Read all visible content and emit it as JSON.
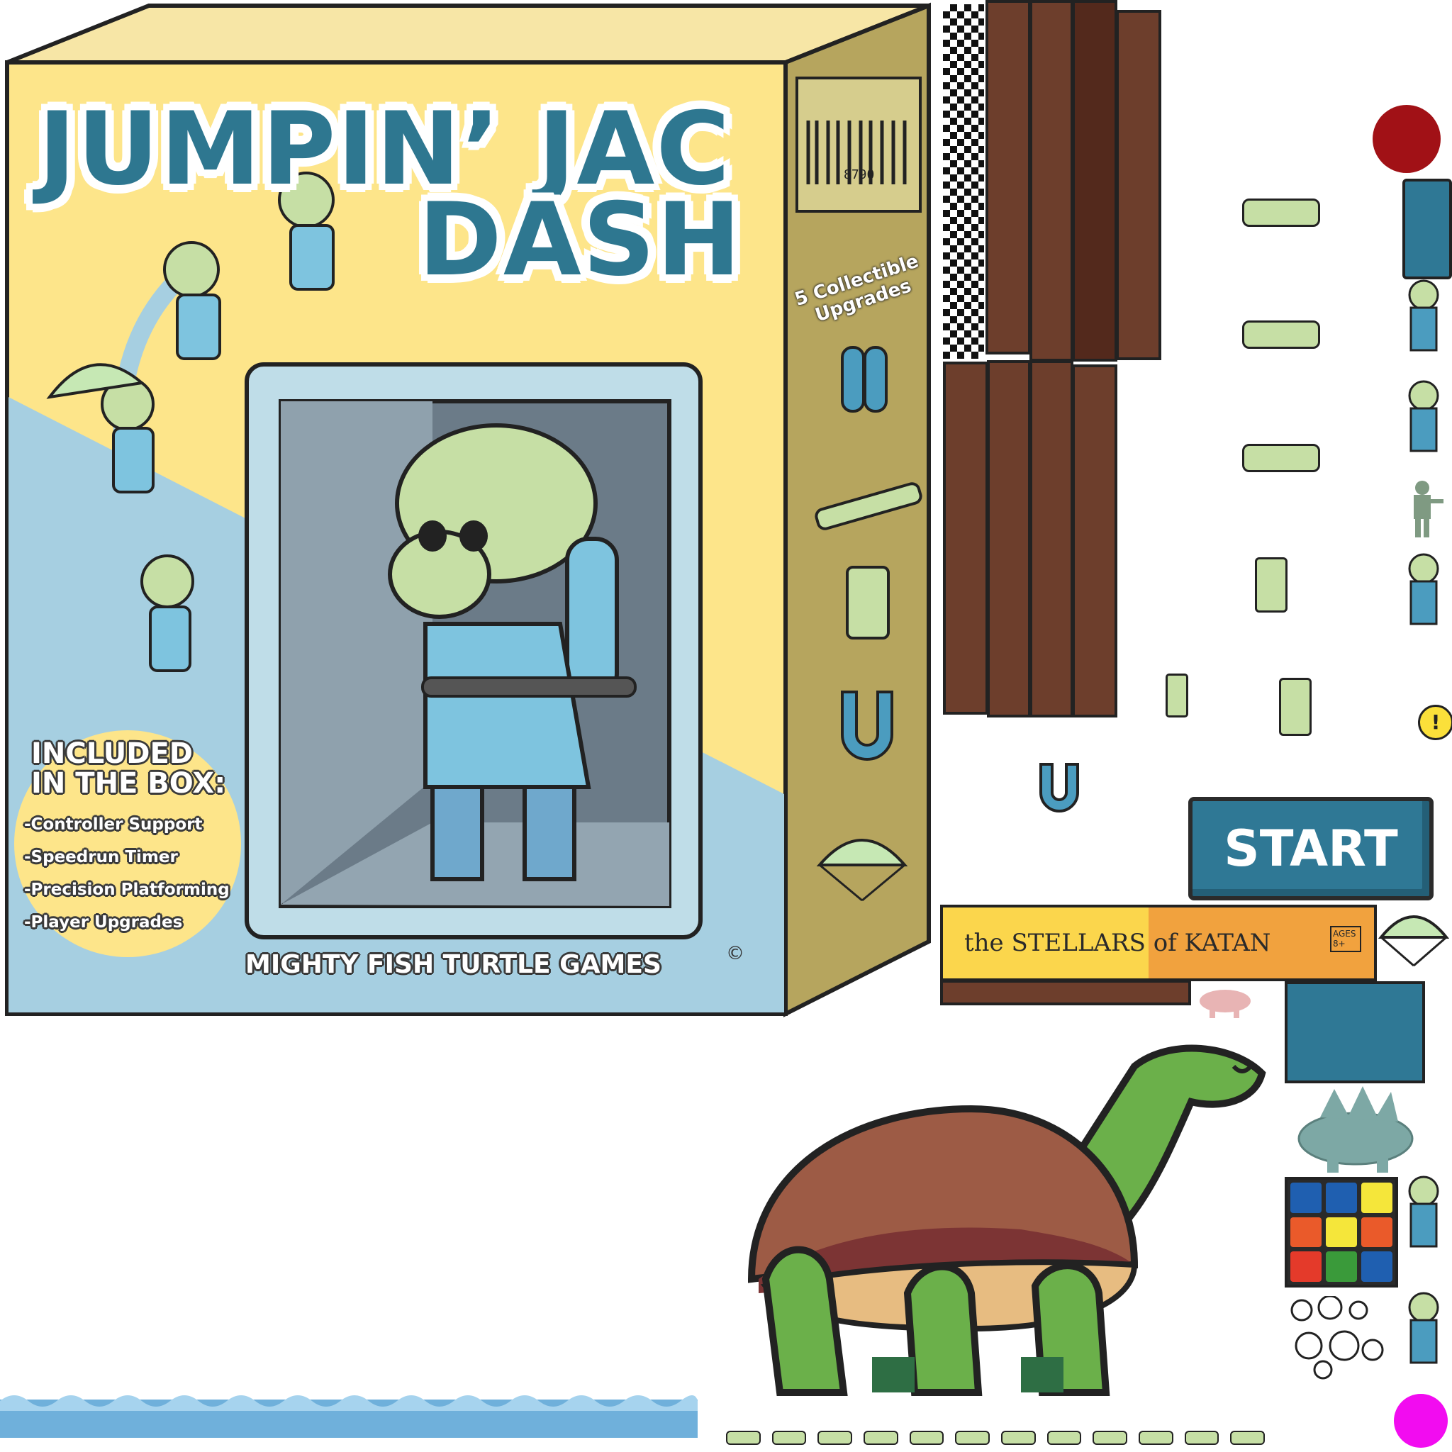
{
  "box": {
    "title_line1": "JUMPIN’ JAC",
    "title_line2": "DASH",
    "side_label": "5 Collectible Upgrades",
    "barcode_number": "8790",
    "included_heading_line1": "INCLUDED",
    "included_heading_line2": "IN THE BOX:",
    "features": [
      "-Controller Support",
      "-Speedrun Timer",
      "-Precision Platforming",
      "-Player Upgrades"
    ],
    "publisher": "MIGHTY FISH TURTLE GAMES",
    "copyright_mark": "©"
  },
  "start_button": {
    "label": "START"
  },
  "stellars_box": {
    "title": "the STELLARS of KATAN",
    "ages": "AGES 8+"
  },
  "icons": {
    "upgrades": [
      "jetpack-icon",
      "rockets-icon",
      "battery-icon",
      "magnet-icon",
      "parachute-icon"
    ],
    "warning": "warning-icon"
  },
  "colors": {
    "box_yellow": "#fde58a",
    "box_blue": "#a6cfe1",
    "box_side": "#b6a55e",
    "title_teal": "#2e7790",
    "wood": "#6d3e2c",
    "red_ball": "#a11116",
    "magenta_ball": "#f20cf0",
    "water": "#6fb0db"
  }
}
